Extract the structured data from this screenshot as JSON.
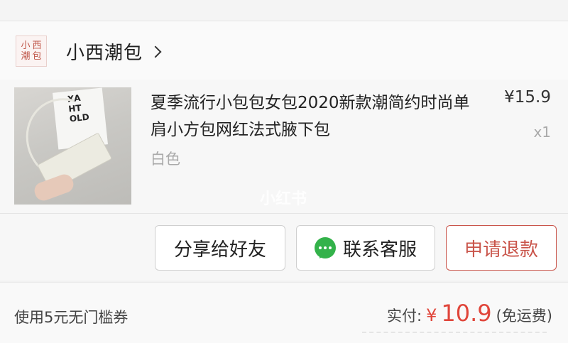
{
  "shop": {
    "logo_chars": [
      "小",
      "西",
      "潮",
      "包"
    ],
    "name": "小西潮包"
  },
  "product": {
    "title": "夏季流行小包包女包2020新款潮简约时尚单肩小方包网红法式腋下包",
    "variant": "白色",
    "price": "¥15.9",
    "quantity": "x1",
    "thumb_text": "XA\nHT\nOLD"
  },
  "watermark": "小红书",
  "actions": {
    "share": "分享给好友",
    "service": "联系客服",
    "refund": "申请退款"
  },
  "footer": {
    "coupon": "使用5元无门槛券",
    "paid_label": "实付:",
    "currency": "¥",
    "amount": "10.9",
    "shipping": "(免运费)"
  },
  "colors": {
    "accent_red": "#e0453a",
    "refund_red": "#c9544a",
    "wechat_green": "#33b24a"
  }
}
